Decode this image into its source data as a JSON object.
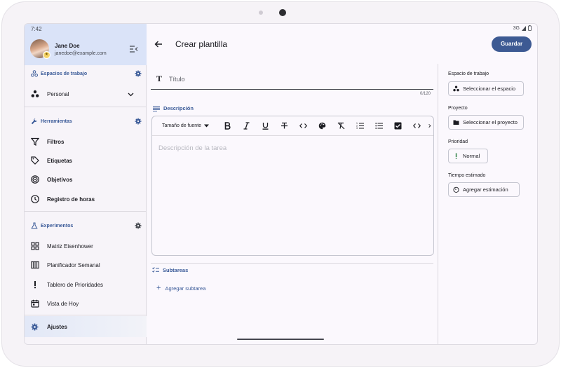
{
  "status": {
    "time": "7:42",
    "network": "3G"
  },
  "profile": {
    "name": "Jane Doe",
    "email": "janedoe@example.com"
  },
  "sidebar": {
    "workspaces": {
      "title": "Espacios de trabajo",
      "current": "Personal"
    },
    "tools": {
      "title": "Herramientas",
      "items": [
        {
          "label": "Filtros",
          "icon": "filter-icon"
        },
        {
          "label": "Etiquetas",
          "icon": "tag-icon"
        },
        {
          "label": "Objetivos",
          "icon": "target-icon"
        },
        {
          "label": "Registro de horas",
          "icon": "clock-icon"
        }
      ]
    },
    "experiments": {
      "title": "Experimentos",
      "items": [
        {
          "label": "Matriz Eisenhower",
          "icon": "grid-icon"
        },
        {
          "label": "Planificador Semanal",
          "icon": "week-view-icon"
        },
        {
          "label": "Tablero de Prioridades",
          "icon": "exclamation-icon"
        },
        {
          "label": "Vista de Hoy",
          "icon": "calendar-icon"
        }
      ]
    },
    "settings_label": "Ajustes"
  },
  "header": {
    "title": "Crear plantilla",
    "save_label": "Guardar"
  },
  "form": {
    "title_placeholder": "Título",
    "title_value": "",
    "title_counter": "0/120",
    "description_label": "Descripción",
    "font_size_label": "Tamaño de fuente",
    "description_placeholder": "Descripción de la tarea",
    "subtasks_label": "Subtareas",
    "add_subtask_label": "Agregar subtarea"
  },
  "properties": {
    "workspace": {
      "label": "Espacio de trabajo",
      "value": "Seleccionar el espacio"
    },
    "project": {
      "label": "Proyecto",
      "value": "Seleccionar el proyecto"
    },
    "priority": {
      "label": "Prioridad",
      "value": "Normal"
    },
    "estimate": {
      "label": "Tiempo estimado",
      "value": "Agregar estimación"
    }
  },
  "colors": {
    "accent": "#3d5a93",
    "profile_bg": "#dae3f8",
    "section_title": "#3a5a98"
  }
}
